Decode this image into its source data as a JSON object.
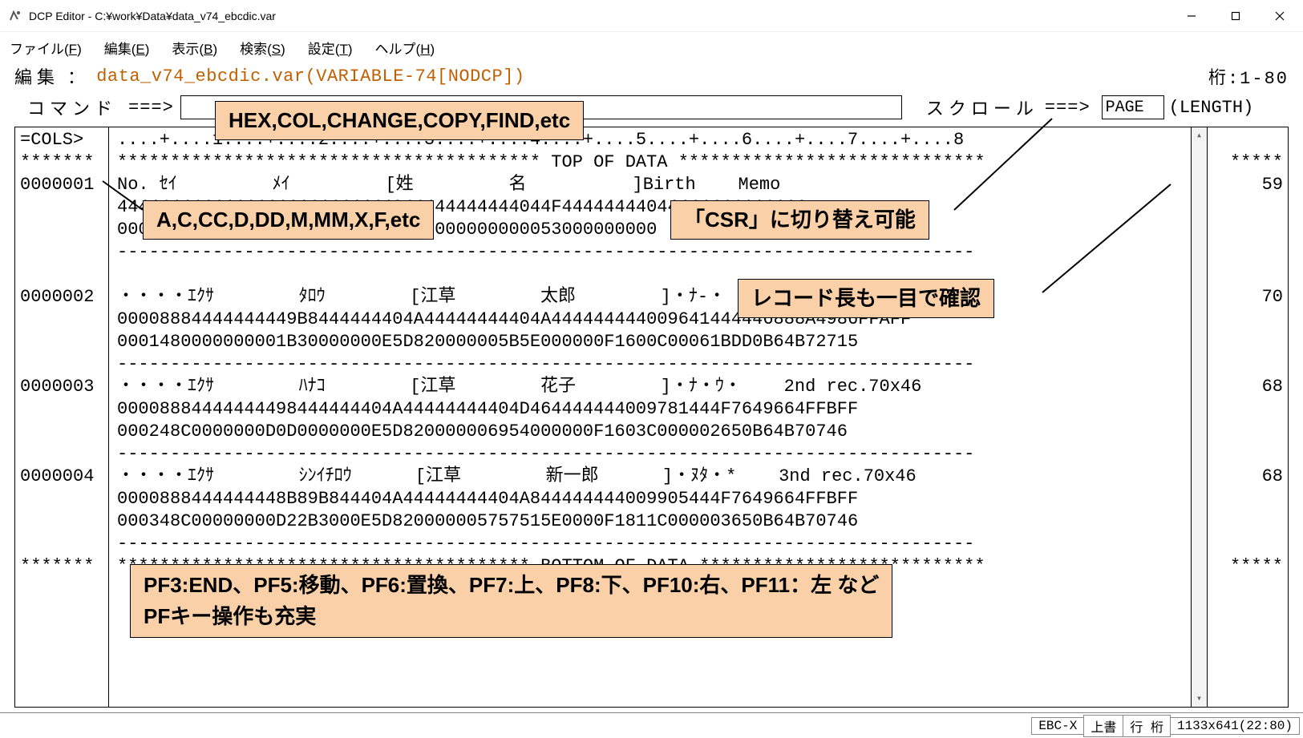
{
  "titlebar": {
    "app_name": "DCP Editor",
    "path": "C:¥work¥Data¥data_v74_ebcdic.var"
  },
  "menubar": [
    {
      "label": "ファイル",
      "mn": "F"
    },
    {
      "label": "編集",
      "mn": "E"
    },
    {
      "label": "表示",
      "mn": "B"
    },
    {
      "label": "検索",
      "mn": "S"
    },
    {
      "label": "設定",
      "mn": "T"
    },
    {
      "label": "ヘルプ",
      "mn": "H"
    }
  ],
  "infoline": {
    "mode": "編集",
    "sep": "：",
    "filename": "data_v74_ebcdic.var(VARIABLE-74[NODCP])",
    "cols": "桁:1-80"
  },
  "cmdrow": {
    "cmd_label": "コマンド",
    "arrow": "===>",
    "cmd_value": "",
    "scroll_label": "スクロール",
    "scroll_value": "PAGE",
    "length": "(LENGTH)"
  },
  "gutter_left": [
    "=COLS> ",
    "*******",
    "0000001",
    "",
    "",
    "",
    "",
    "0000002",
    "",
    "",
    "",
    "0000003",
    "",
    "",
    "",
    "0000004",
    "",
    "",
    "",
    "*******"
  ],
  "gutter_right": [
    "",
    "*****",
    "59",
    "",
    "",
    "",
    "",
    "70",
    "",
    "",
    "",
    "68",
    "",
    "",
    "",
    "68",
    "",
    "",
    "",
    "*****"
  ],
  "main_lines": [
    "....+....1....+....2....+....3....+....4....+....5....+....6....+....7....+....8",
    "**************************************** TOP OF DATA *****************************",
    "No. ｾｲ         ﾒｲ         [姓         名          ]Birth    Memo",
    "44444444444444444444444444044444444444044F44444444044444444444444",
    "000000000000000000000000000530000000000053000000000",
    "---------------------------------------------------------------------------------",
    "",
    "・・・・ｴｸｻ        ﾀﾛｳ        [江草        太郎        ]・ﾅ-・    first rec.78x48",
    "00008884444444449B8444444404A44444444404A444444444009641444446888A4986FFAFF",
    "0001480000000001B30000000E5D820000005B5E000000F1600C00061BDD0B64B72715",
    "---------------------------------------------------------------------------------",
    "・・・・ｴｸｻ        ﾊﾅｺ        [江草        花子        ]・ﾅ・ｳ・    2nd rec.70x46",
    "00008884444444498444444404A44444444404D464444444009781444F7649664FFBFF",
    "000248C0000000D0D0000000E5D820000006954000000F1603C000002650B64B70746",
    "---------------------------------------------------------------------------------",
    "・・・・ｴｸｻ        ｼﾝｲﾁﾛｳ      [江草        新一郎      ]・ﾇﾀ・*    3nd rec.70x46",
    "0000888444444448B89B844404A44444444404A844444444009905444F7649664FFBFF",
    "000348C00000000D22B3000E5D820000005757515E0000F1811C000003650B64B70746",
    "---------------------------------------------------------------------------------",
    "*************************************** BOTTOM OF DATA ***************************"
  ],
  "annotations": {
    "cmd_hint": "HEX,COL,CHANGE,COPY,FIND,etc",
    "line_cmds": "A,C,CC,D,DD,M,MM,X,F,etc",
    "scroll_hint": "「CSR」に切り替え可能",
    "length_hint": "レコード長も一目で確認",
    "pf_hint1": "PF3:END、PF5:移動、PF6:置換、PF7:上、PF8:下、PF10:右、PF11：左 など",
    "pf_hint2": "PFキー操作も充実"
  },
  "statusbar": {
    "enc": "EBC-X",
    "mode": "上書",
    "rc": "行 桁",
    "size": "1133x641(22:80)"
  }
}
